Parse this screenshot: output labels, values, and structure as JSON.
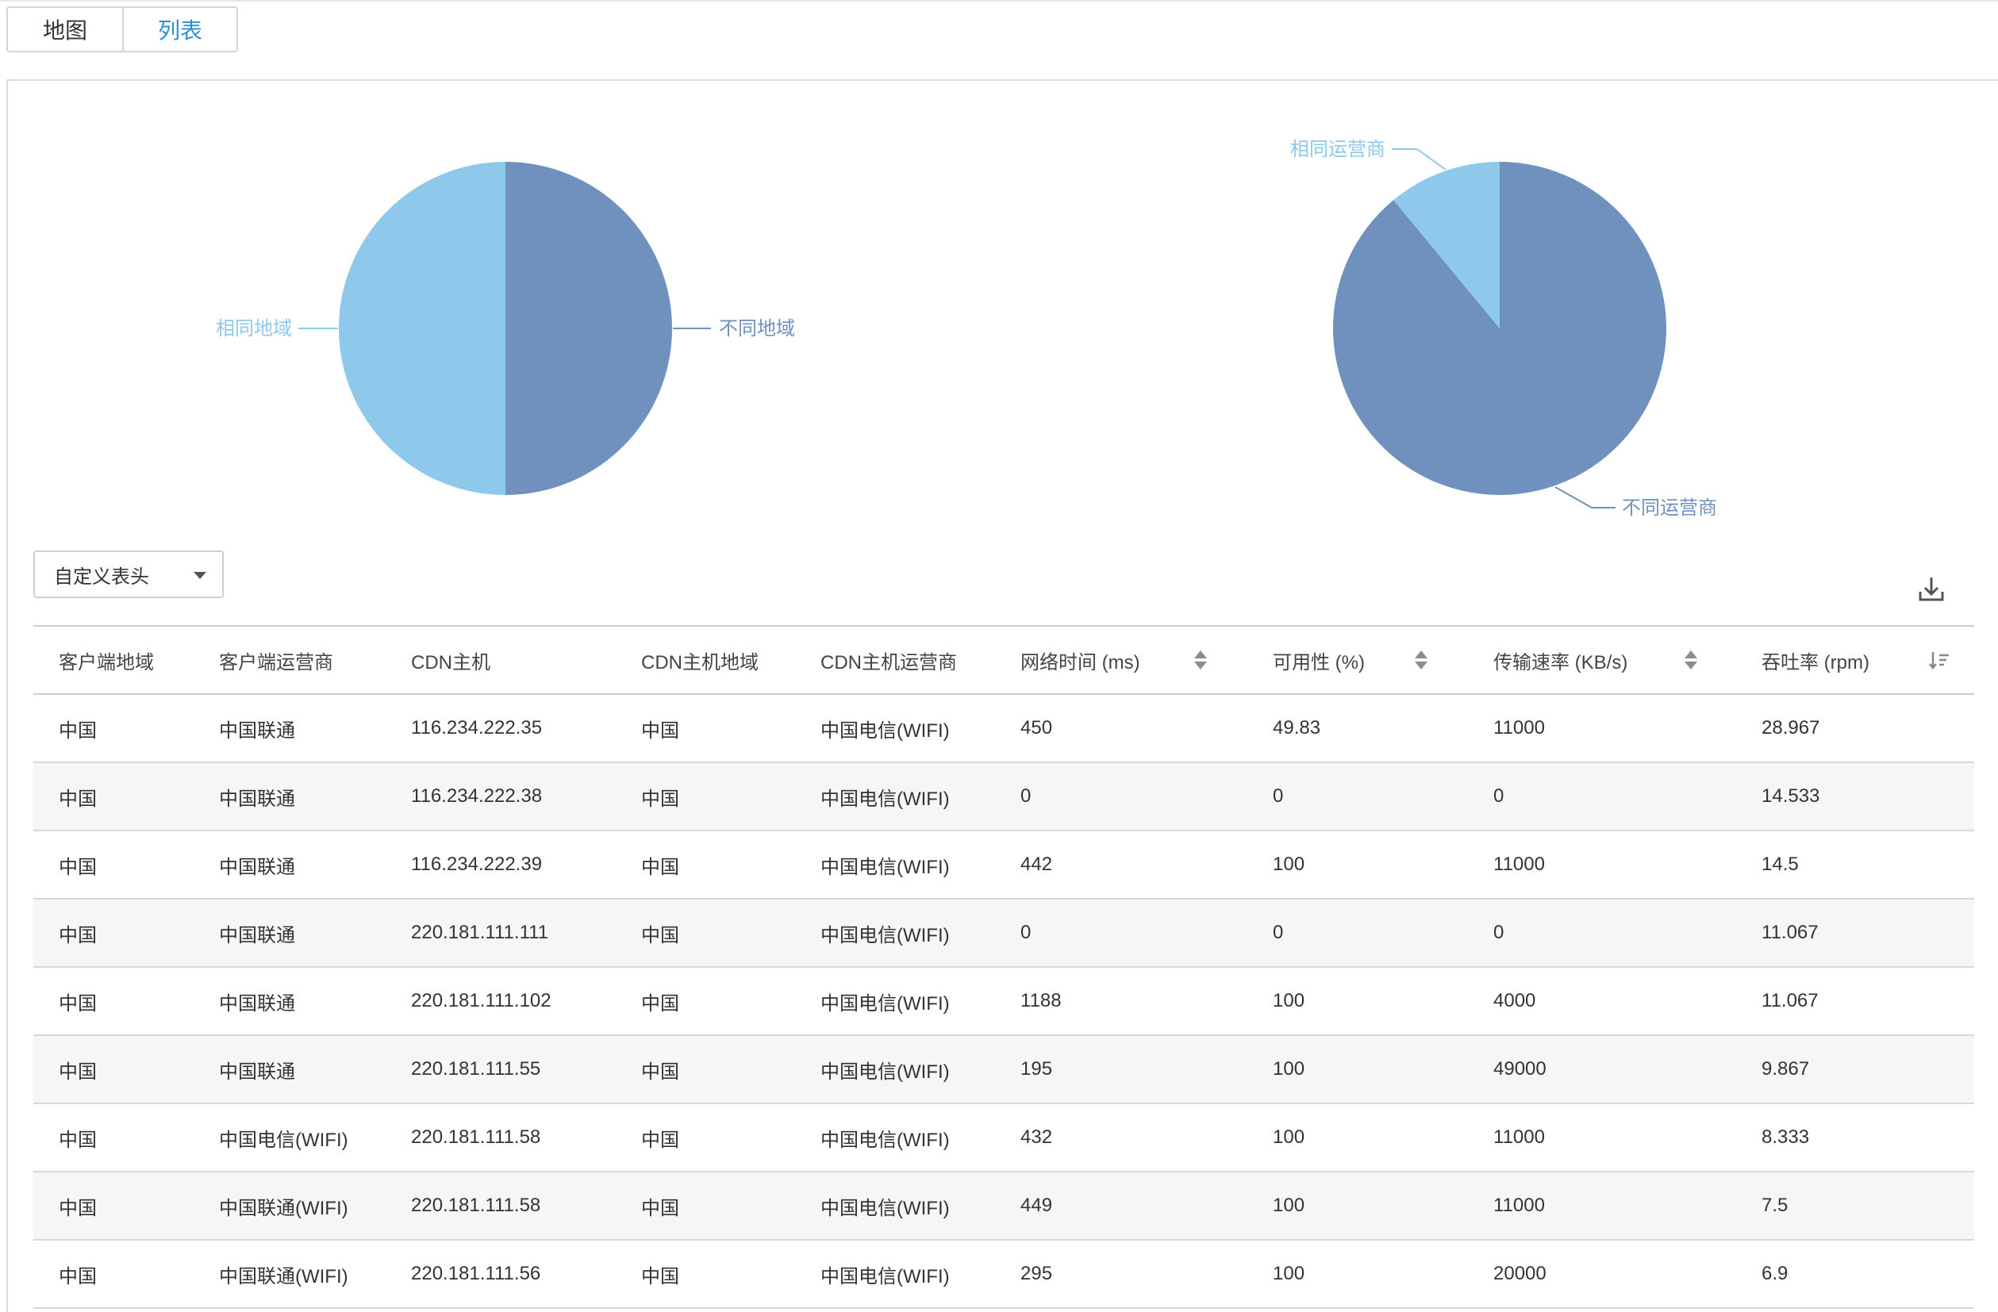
{
  "tabs": [
    {
      "label": "地图",
      "active": false
    },
    {
      "label": "列表",
      "active": true
    }
  ],
  "colors": {
    "accent": "#2f8fd6",
    "slice_light": "#8ec8ea",
    "slice_dark": "#7091bd"
  },
  "chart_data": [
    {
      "type": "pie",
      "slices": [
        {
          "label": "不同地域",
          "value": 50
        },
        {
          "label": "相同地域",
          "value": 50
        }
      ]
    },
    {
      "type": "pie",
      "slices": [
        {
          "label": "不同运营商",
          "value": 89
        },
        {
          "label": "相同运营商",
          "value": 11
        }
      ]
    }
  ],
  "toolbar": {
    "custom_header_label": "自定义表头",
    "download_icon": "download-icon"
  },
  "table": {
    "columns": [
      "客户端地域",
      "客户端运营商",
      "CDN主机",
      "CDN主机地域",
      "CDN主机运营商",
      "网络时间 (ms)",
      "可用性 (%)",
      "传输速率 (KB/s)",
      "吞吐率 (rpm)"
    ],
    "rows": [
      [
        "中国",
        "中国联通",
        "116.234.222.35",
        "中国",
        "中国电信(WIFI)",
        "450",
        "49.83",
        "11000",
        "28.967"
      ],
      [
        "中国",
        "中国联通",
        "116.234.222.38",
        "中国",
        "中国电信(WIFI)",
        "0",
        "0",
        "0",
        "14.533"
      ],
      [
        "中国",
        "中国联通",
        "116.234.222.39",
        "中国",
        "中国电信(WIFI)",
        "442",
        "100",
        "11000",
        "14.5"
      ],
      [
        "中国",
        "中国联通",
        "220.181.111.111",
        "中国",
        "中国电信(WIFI)",
        "0",
        "0",
        "0",
        "11.067"
      ],
      [
        "中国",
        "中国联通",
        "220.181.111.102",
        "中国",
        "中国电信(WIFI)",
        "1188",
        "100",
        "4000",
        "11.067"
      ],
      [
        "中国",
        "中国联通",
        "220.181.111.55",
        "中国",
        "中国电信(WIFI)",
        "195",
        "100",
        "49000",
        "9.867"
      ],
      [
        "中国",
        "中国电信(WIFI)",
        "220.181.111.58",
        "中国",
        "中国电信(WIFI)",
        "432",
        "100",
        "11000",
        "8.333"
      ],
      [
        "中国",
        "中国联通(WIFI)",
        "220.181.111.58",
        "中国",
        "中国电信(WIFI)",
        "449",
        "100",
        "11000",
        "7.5"
      ],
      [
        "中国",
        "中国联通(WIFI)",
        "220.181.111.56",
        "中国",
        "中国电信(WIFI)",
        "295",
        "100",
        "20000",
        "6.9"
      ]
    ]
  }
}
